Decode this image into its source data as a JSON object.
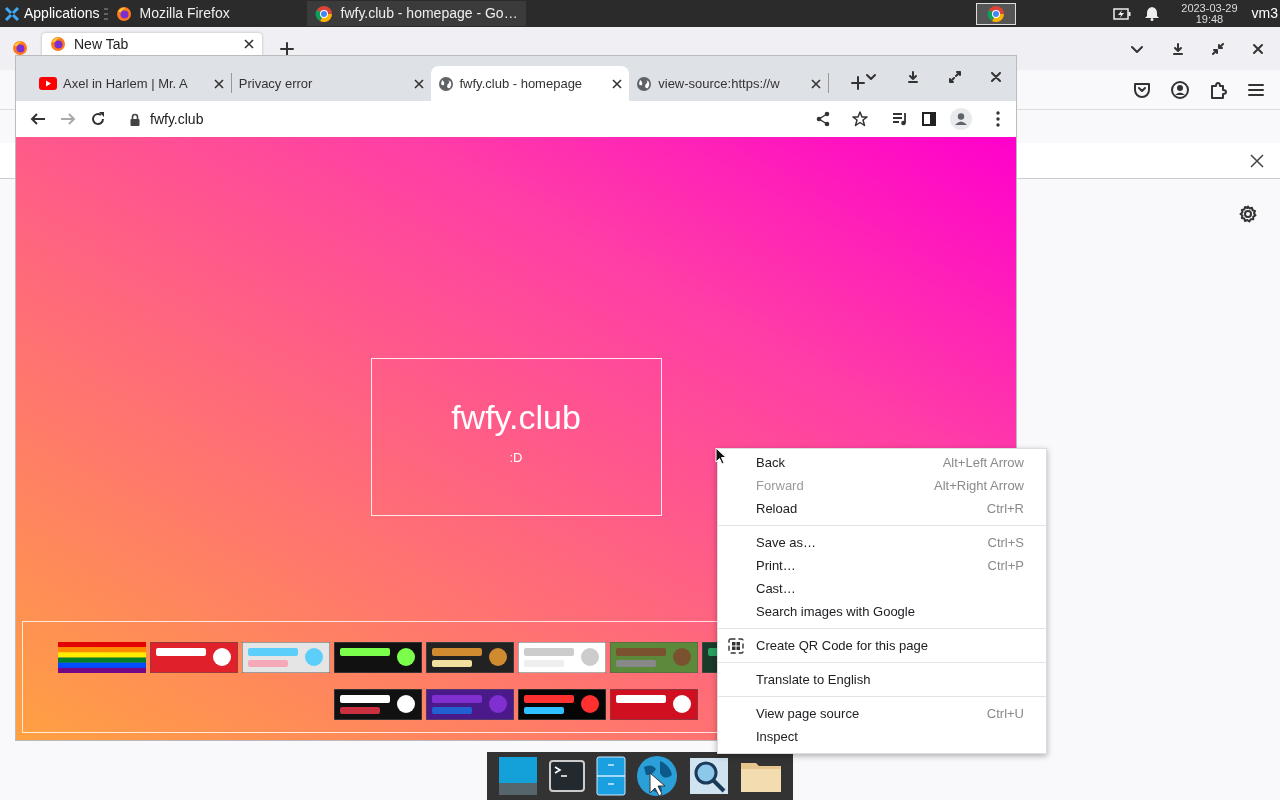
{
  "top_panel": {
    "menu_label": "Applications",
    "tasks": [
      {
        "title": "Mozilla Firefox",
        "selected": false
      },
      {
        "title": "fwfy.club - homepage - Go…",
        "selected": true
      }
    ],
    "date": "2023-03-29",
    "time": "19:48",
    "user": "vm3"
  },
  "firefox_window": {
    "tabs": [
      {
        "title": "New Tab",
        "selected": true
      }
    ]
  },
  "chrome_window": {
    "tabs": [
      {
        "title": "Axel in Harlem | Mr. A",
        "selected": false
      },
      {
        "title": "Privacy error",
        "selected": false
      },
      {
        "title": "fwfy.club - homepage",
        "selected": true
      },
      {
        "title": "view-source:https://w",
        "selected": false
      }
    ],
    "back": {
      "disabled": false
    },
    "forward": {
      "disabled": true
    },
    "address": "fwfy.club"
  },
  "page": {
    "heading": "fwfy.club",
    "subtext": ":D"
  },
  "context_menu": {
    "sections": [
      {
        "items": [
          {
            "label": "Back",
            "shortcut": "Alt+Left Arrow",
            "kind": "plain",
            "disabled": false
          },
          {
            "label": "Forward",
            "shortcut": "Alt+Right Arrow",
            "kind": "plain",
            "disabled": true
          },
          {
            "label": "Reload",
            "shortcut": "Ctrl+R",
            "kind": "plain",
            "disabled": false
          }
        ]
      },
      {
        "items": [
          {
            "label": "Save as…",
            "shortcut": "Ctrl+S",
            "kind": "plain",
            "disabled": false
          },
          {
            "label": "Print…",
            "shortcut": "Ctrl+P",
            "kind": "plain",
            "disabled": false
          },
          {
            "label": "Cast…",
            "kind": "plain",
            "disabled": false
          },
          {
            "label": "Search images with Google",
            "kind": "plain",
            "disabled": false
          }
        ]
      },
      {
        "items": [
          {
            "label": "Create QR Code for this page",
            "kind": "qr",
            "disabled": false
          }
        ]
      },
      {
        "items": [
          {
            "label": "Translate to English",
            "kind": "plain",
            "disabled": false
          }
        ]
      },
      {
        "items": [
          {
            "label": "View page source",
            "shortcut": "Ctrl+U",
            "kind": "plain",
            "disabled": false
          },
          {
            "label": "Inspect",
            "kind": "plain",
            "disabled": false
          }
        ]
      }
    ]
  }
}
